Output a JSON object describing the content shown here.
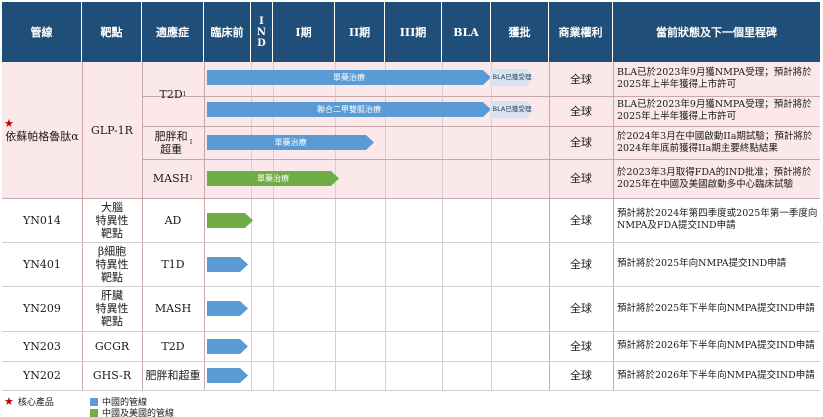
{
  "headers": {
    "pipeline": "管線",
    "target": "靶點",
    "indication": "適應症",
    "preclinical": "臨床前",
    "ind": "IND",
    "phase1": "I期",
    "phase2": "II期",
    "phase3": "III期",
    "bla": "BLA",
    "approved": "獲批",
    "rights": "商業權利",
    "status": "當前狀態及下一個里程碑"
  },
  "products": {
    "p1": {
      "name": "依蘇帕格魯肽α",
      "target": "GLP-1R"
    },
    "p2": {
      "name": "YN014",
      "target": "大腦\n特異性\n靶點"
    },
    "p3": {
      "name": "YN401",
      "target": "β細胞\n特異性\n靶點"
    },
    "p4": {
      "name": "YN209",
      "target": "肝臟\n特異性\n靶點"
    },
    "p5": {
      "name": "YN203",
      "target": "GCGR"
    },
    "p6": {
      "name": "YN202",
      "target": "GHS-R"
    }
  },
  "rows": {
    "r1": {
      "indication": "T2D",
      "sup": "1",
      "bar": "單藥治療",
      "bla": "BLA已獲受理",
      "rights": "全球",
      "status": "BLA已於2023年9月獲NMPA受理；預計將於2025年上半年獲得上市許可"
    },
    "r2": {
      "bar": "聯合二甲雙胍治療",
      "bla": "BLA已獲受理",
      "rights": "全球",
      "status": "BLA已於2023年9月獲NMPA受理；預計將於2025年上半年獲得上市許可"
    },
    "r3": {
      "indication": "肥胖和超重",
      "sup": "1",
      "bar": "單藥治療",
      "rights": "全球",
      "status": "於2024年3月在中國啟動IIa期試驗；預計將於2024年年底前獲得IIa期主要終點結果"
    },
    "r4": {
      "indication": "MASH",
      "sup": "1",
      "bar": "單藥治療",
      "rights": "全球",
      "status": "於2023年3月取得FDA的IND批准；預計將於2025年在中國及美國啟動多中心臨床試驗"
    },
    "r5": {
      "indication": "AD",
      "rights": "全球",
      "status": "預計將於2024年第四季度或2025年第一季度向NMPA及FDA提交IND申請"
    },
    "r6": {
      "indication": "T1D",
      "rights": "全球",
      "status": "預計將於2025年向NMPA提交IND申請"
    },
    "r7": {
      "indication": "MASH",
      "rights": "全球",
      "status": "預計將於2025年下半年向NMPA提交IND申請"
    },
    "r8": {
      "indication": "T2D",
      "rights": "全球",
      "status": "預計將於2026年下半年向NMPA提交IND申請"
    },
    "r9": {
      "indication": "肥胖和超重",
      "rights": "全球",
      "status": "預計將於2026年下半年向NMPA提交IND申請"
    }
  },
  "legend": {
    "core": "核心產品",
    "china": "中國的管線",
    "china_us": "中國及美國的管線"
  },
  "colors": {
    "header": "#1f4e79",
    "china": "#5b9bd5",
    "china_us": "#70ad47",
    "core_star": "#c00000",
    "band": "#fbe8ea"
  },
  "icons": {
    "core_marker": "★"
  }
}
